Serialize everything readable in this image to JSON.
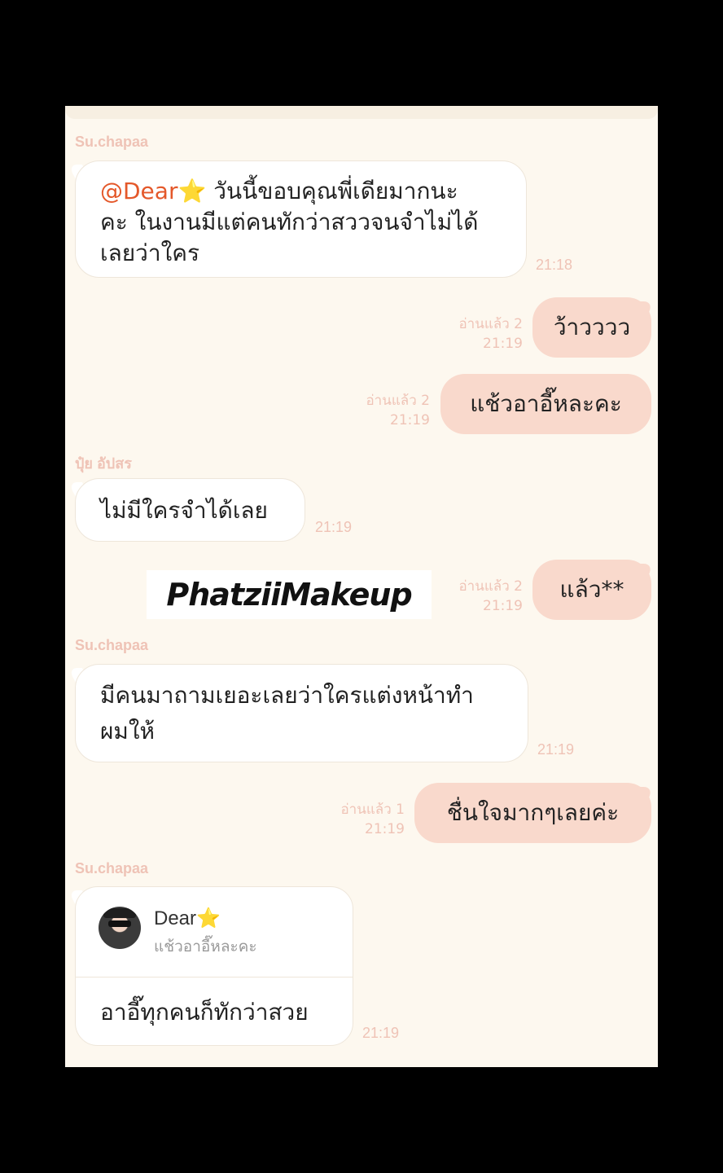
{
  "messages": [
    {
      "sender": "Su.chapaa",
      "mention": "@Dear",
      "star": "⭐",
      "text_l1": " วันนี้ขอบคุณพี่เดียมากนะ",
      "text_l2": "คะ ในงานมีแต่คนทักว่าสววจนจำไม่ได้",
      "text_l3": "เลยว่าใคร",
      "time": "21:18"
    },
    {
      "text": "ว้าวววว",
      "read": "อ่านแล้ว 2",
      "time": "21:19"
    },
    {
      "text": "แช้วอาอี๊หละคะ",
      "read": "อ่านแล้ว 2",
      "time": "21:19"
    },
    {
      "sender": "ปุ๋ย อัปสร",
      "text": "ไม่มีใครจำได้เลย",
      "time": "21:19"
    },
    {
      "text": "แล้ว**",
      "read": "อ่านแล้ว 2",
      "time": "21:19"
    },
    {
      "sender": "Su.chapaa",
      "text_l1": "มีคนมาถามเยอะเลยว่าใครแต่งหน้าทำ",
      "text_l2": "ผมให้",
      "time": "21:19"
    },
    {
      "text": "ชื่นใจมากๆเลยค่ะ",
      "read": "อ่านแล้ว 1",
      "time": "21:19"
    },
    {
      "sender": "Su.chapaa",
      "reply_name": "Dear",
      "reply_star": "⭐",
      "reply_quote": "แช้วอาอี๊หละคะ",
      "text": "อาอี๊ทุกคนก็ทักว่าสวย",
      "time": "21:19"
    }
  ],
  "watermark": "PhatziiMakeup",
  "colors": {
    "background": "#fdf8ef",
    "outgoing_bubble": "#f9d9cc",
    "incoming_bubble": "#ffffff",
    "meta_text": "#efc3b6",
    "mention": "#e4582a"
  }
}
